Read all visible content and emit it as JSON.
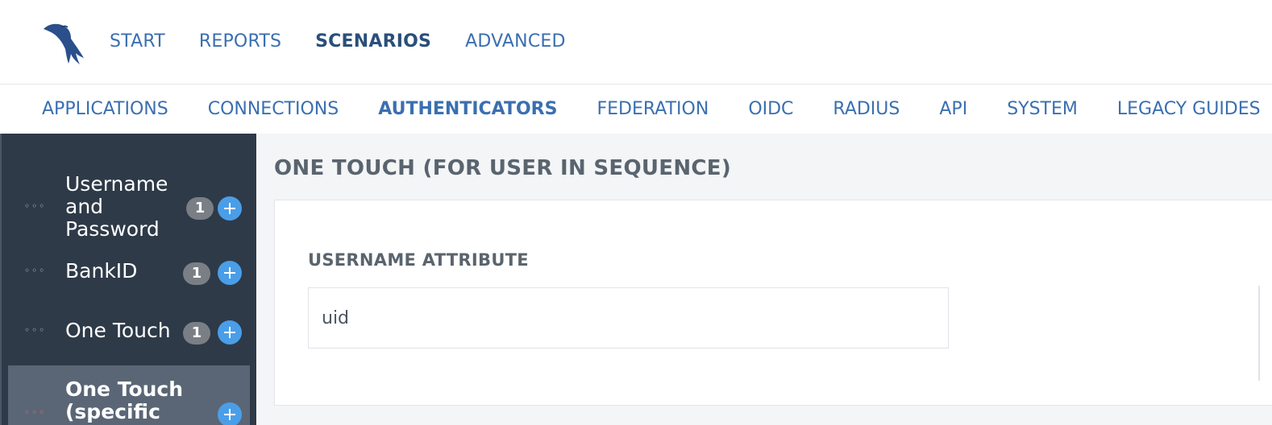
{
  "top_nav": {
    "items": [
      {
        "label": "START"
      },
      {
        "label": "REPORTS"
      },
      {
        "label": "SCENARIOS",
        "active": true
      },
      {
        "label": "ADVANCED"
      }
    ]
  },
  "sub_nav": {
    "items": [
      {
        "label": "APPLICATIONS"
      },
      {
        "label": "CONNECTIONS"
      },
      {
        "label": "AUTHENTICATORS",
        "active": true
      },
      {
        "label": "FEDERATION"
      },
      {
        "label": "OIDC"
      },
      {
        "label": "RADIUS"
      },
      {
        "label": "API"
      },
      {
        "label": "SYSTEM"
      },
      {
        "label": "LEGACY GUIDES"
      }
    ]
  },
  "sidebar": {
    "items": [
      {
        "label_lines": [
          "Username",
          "and",
          "Password"
        ],
        "badge": "1",
        "plus_icon": "plus-icon"
      },
      {
        "label_lines": [
          "BankID"
        ],
        "badge": "1",
        "plus_icon": "plus-icon"
      },
      {
        "label_lines": [
          "One Touch"
        ],
        "badge": "1",
        "plus_icon": "plus-icon"
      },
      {
        "label_lines": [
          "One Touch",
          "(specific"
        ],
        "plus_icon": "plus-icon",
        "selected": true
      }
    ]
  },
  "main": {
    "title": "ONE TOUCH (FOR USER IN SEQUENCE)",
    "field": {
      "label": "USERNAME ATTRIBUTE",
      "value": "uid"
    }
  },
  "colors": {
    "sidebar_bg": "#2e3a48",
    "sidebar_selected": "#5a6675",
    "link_blue": "#3a6fb0",
    "plus_blue": "#4a9ee8",
    "badge_gray": "#7a7f86"
  }
}
